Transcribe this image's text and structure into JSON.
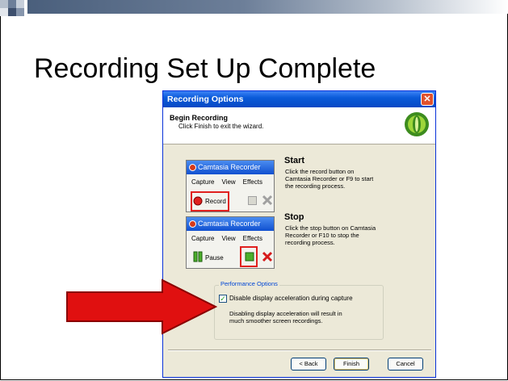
{
  "slide": {
    "title": "Recording Set Up Complete"
  },
  "dialog": {
    "title": "Recording Options",
    "close_glyph": "✕",
    "header_title": "Begin Recording",
    "header_subtitle": "Click Finish to exit the wizard.",
    "start": {
      "recorder_title": "Camtasia Recorder",
      "menu": [
        "Capture",
        "View",
        "Effects"
      ],
      "button_label": "Record",
      "heading": "Start",
      "text": "Click the record button on Camtasia Recorder or F9 to start the recording process."
    },
    "stop": {
      "recorder_title": "Camtasia Recorder",
      "menu": [
        "Capture",
        "View",
        "Effects"
      ],
      "button_label": "Pause",
      "heading": "Stop",
      "text": "Click the stop button on Camtasia Recorder or F10 to stop the recording process."
    },
    "performance": {
      "legend": "Performance Options",
      "checkbox_label": "Disable display acceleration during capture",
      "checkbox_checked": true,
      "note": "Disabling display acceleration will result in much smoother screen recordings."
    },
    "buttons": {
      "back": "< Back",
      "finish": "Finish",
      "cancel": "Cancel"
    }
  },
  "colors": {
    "accent_red": "#e0201e",
    "xp_blue": "#0a5bd9"
  }
}
